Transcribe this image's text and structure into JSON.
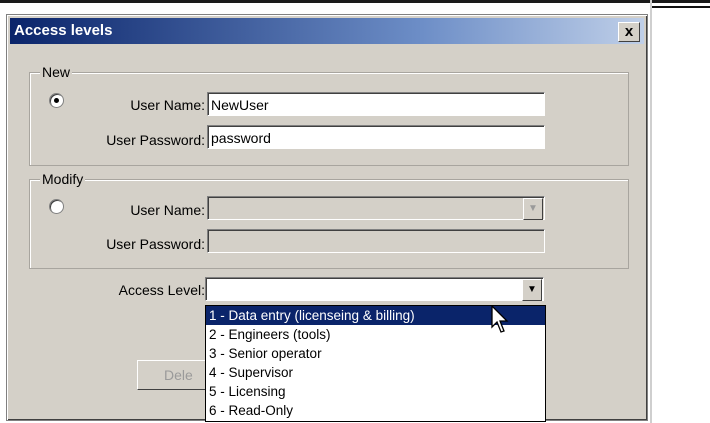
{
  "dialog": {
    "title": "Access levels",
    "close_label": "x"
  },
  "new_group": {
    "legend": "New",
    "radio_selected": true,
    "user_name_label": "User Name:",
    "user_name_value": "NewUser",
    "password_label": "User Password:",
    "password_value": "password"
  },
  "modify_group": {
    "legend": "Modify",
    "radio_selected": false,
    "user_name_label": "User Name:",
    "user_name_value": "",
    "password_label": "User Password:",
    "password_value": ""
  },
  "access_level": {
    "label": "Access Level:",
    "value": "",
    "options": [
      "1 - Data entry (licenseing & billing)",
      "2 - Engineers (tools)",
      "3 - Senior operator",
      "4 - Supervisor",
      "5 - Licensing",
      "6 - Read-Only"
    ],
    "highlighted_index": 0
  },
  "buttons": {
    "delete_label": "Dele"
  },
  "colors": {
    "titlebar": "#0a246a",
    "dialog_bg": "#d4d0c8",
    "selection": "#0a246a"
  }
}
